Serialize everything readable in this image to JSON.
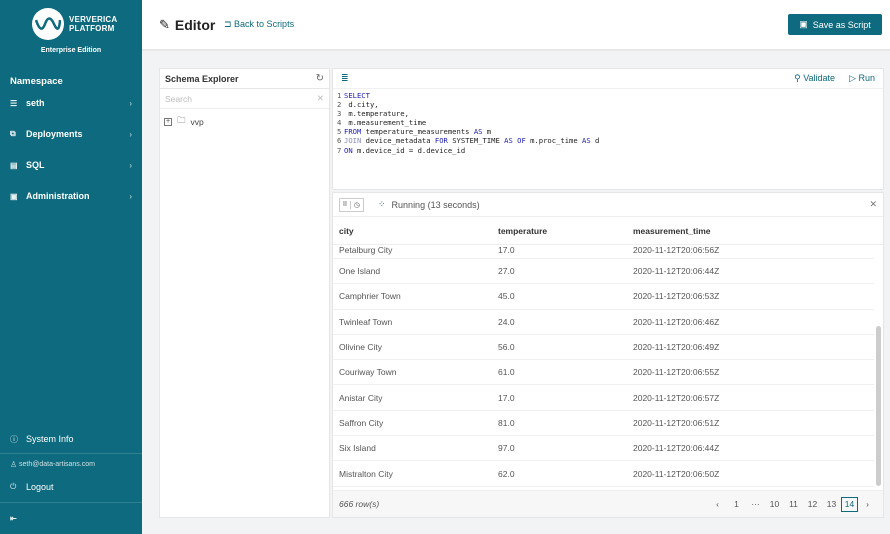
{
  "brand": {
    "line1": "VERVERICA",
    "line2": "PLATFORM",
    "edition": "Enterprise Edition"
  },
  "sidebar": {
    "namespace_label": "Namespace",
    "items": [
      {
        "label": "seth",
        "icon": "list-icon"
      },
      {
        "label": "Deployments",
        "icon": "deployments-icon"
      },
      {
        "label": "SQL",
        "icon": "sql-icon"
      },
      {
        "label": "Administration",
        "icon": "admin-icon"
      }
    ],
    "system_info": "System Info",
    "user": "seth@data-artisans.com",
    "logout": "Logout"
  },
  "header": {
    "title": "Editor",
    "back": "Back to Scripts",
    "save": "Save as Script"
  },
  "schema": {
    "title": "Schema Explorer",
    "search_placeholder": "Search",
    "tree": [
      {
        "label": "vvp"
      }
    ]
  },
  "editor": {
    "validate": "Validate",
    "run": "Run",
    "lines": [
      [
        [
          "SELECT",
          "kw"
        ]
      ],
      [
        [
          " d.city,",
          ""
        ]
      ],
      [
        [
          " m.temperature,",
          ""
        ]
      ],
      [
        [
          " m.measurement_time",
          ""
        ]
      ],
      [
        [
          "FROM",
          "kw"
        ],
        [
          " temperature_measurements ",
          ""
        ],
        [
          "AS",
          "kw"
        ],
        [
          " m",
          ""
        ]
      ],
      [
        [
          "JOIN",
          "kw2"
        ],
        [
          " device_metadata ",
          ""
        ],
        [
          "FOR",
          "kw"
        ],
        [
          " SYSTEM_TIME ",
          ""
        ],
        [
          "AS",
          "kw"
        ],
        [
          " ",
          ""
        ],
        [
          "OF",
          "kw"
        ],
        [
          " m.proc_time ",
          ""
        ],
        [
          "AS",
          "kw"
        ],
        [
          " d",
          ""
        ]
      ],
      [
        [
          "ON",
          "kw"
        ],
        [
          " m.device_id = d.device_id",
          ""
        ]
      ]
    ]
  },
  "results": {
    "status": "Running (13 seconds)",
    "columns": [
      "city",
      "temperature",
      "measurement_time"
    ],
    "rows": [
      [
        "Petalburg City",
        "17.0",
        "2020-11-12T20:06:56Z"
      ],
      [
        "One Island",
        "27.0",
        "2020-11-12T20:06:44Z"
      ],
      [
        "Camphrier Town",
        "45.0",
        "2020-11-12T20:06:53Z"
      ],
      [
        "Twinleaf Town",
        "24.0",
        "2020-11-12T20:06:46Z"
      ],
      [
        "Olivine City",
        "56.0",
        "2020-11-12T20:06:49Z"
      ],
      [
        "Couriway Town",
        "61.0",
        "2020-11-12T20:06:55Z"
      ],
      [
        "Anistar City",
        "17.0",
        "2020-11-12T20:06:57Z"
      ],
      [
        "Saffron City",
        "81.0",
        "2020-11-12T20:06:51Z"
      ],
      [
        "Six Island",
        "97.0",
        "2020-11-12T20:06:44Z"
      ],
      [
        "Mistralton City",
        "62.0",
        "2020-11-12T20:06:50Z"
      ]
    ],
    "row_count": "666 row(s)",
    "pages": [
      "1",
      "···",
      "10",
      "11",
      "12",
      "13",
      "14"
    ],
    "current_page": "14"
  }
}
